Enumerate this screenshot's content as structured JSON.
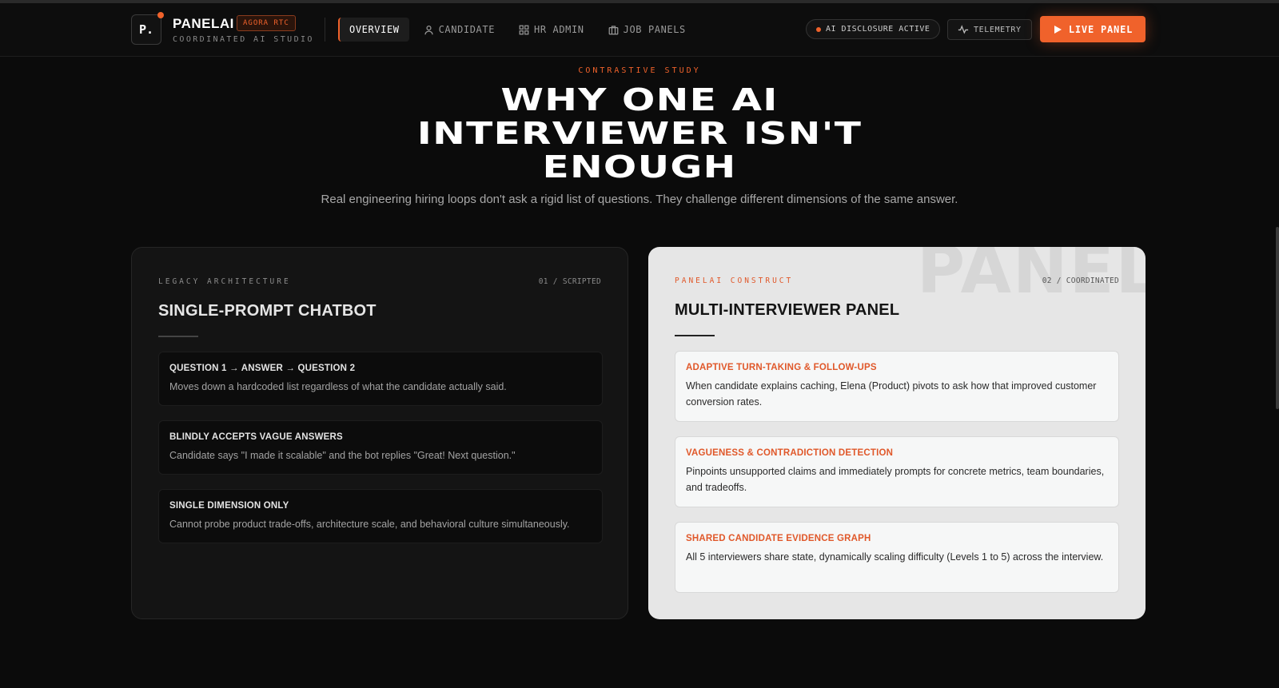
{
  "nav": {
    "logo_mark": "P.",
    "brand": "PANELAI",
    "brand_tag": "AGORA RTC",
    "brand_sub": "COORDINATED AI STUDIO",
    "tabs": [
      {
        "label": "OVERVIEW",
        "icon": "none",
        "active": true
      },
      {
        "label": "CANDIDATE",
        "icon": "user-icon",
        "active": false
      },
      {
        "label": "HR ADMIN",
        "icon": "grid-icon",
        "active": false
      },
      {
        "label": "JOB PANELS",
        "icon": "briefcase-icon",
        "active": false
      }
    ],
    "disclosure": "AI DISCLOSURE ACTIVE",
    "telemetry": "TELEMETRY",
    "live_panel": "LIVE PANEL"
  },
  "hero": {
    "eyebrow": "CONTRASTIVE STUDY",
    "headline_line1": "WHY ONE AI",
    "headline_line2": "INTERVIEWER ISN'T",
    "headline_line3": "ENOUGH",
    "subline": "Real engineering hiring loops don't ask a rigid list of questions. They challenge different dimensions of the same answer."
  },
  "legacy": {
    "eyebrow": "LEGACY ARCHITECTURE",
    "number": "01 / SCRIPTED",
    "title": "SINGLE-PROMPT CHATBOT",
    "items": [
      {
        "title": "QUESTION 1 → ANSWER → QUESTION 2",
        "desc": "Moves down a hardcoded list regardless of what the candidate actually said."
      },
      {
        "title": "BLINDLY ACCEPTS VAGUE ANSWERS",
        "desc": "Candidate says \"I made it scalable\" and the bot replies \"Great! Next question.\""
      },
      {
        "title": "SINGLE DIMENSION ONLY",
        "desc": "Cannot probe product trade-offs, architecture scale, and behavioral culture simultaneously."
      }
    ]
  },
  "panel": {
    "watermark": "PANEL",
    "eyebrow": "PANELAI CONSTRUCT",
    "number": "02 / COORDINATED",
    "title": "MULTI-INTERVIEWER PANEL",
    "items": [
      {
        "title": "ADAPTIVE TURN-TAKING & FOLLOW-UPS",
        "desc": "When candidate explains caching, Elena (Product) pivots to ask how that improved customer conversion rates."
      },
      {
        "title": "VAGUENESS & CONTRADICTION DETECTION",
        "desc": "Pinpoints unsupported claims and immediately prompts for concrete metrics, team boundaries, and tradeoffs."
      },
      {
        "title": "SHARED CANDIDATE EVIDENCE GRAPH",
        "desc": "All 5 interviewers share state, dynamically scaling difficulty (Levels 1 to 5) across the interview."
      }
    ]
  },
  "colors": {
    "accent": "#f0622b",
    "background": "#0b0b0b",
    "panel_card": "#e6e6e6"
  }
}
